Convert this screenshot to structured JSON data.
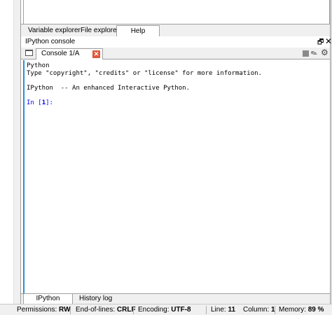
{
  "top_tabs": [
    {
      "label": "Variable explorer"
    },
    {
      "label": "File explorer"
    },
    {
      "label": "Help"
    }
  ],
  "console_pane": {
    "title": "IPython console",
    "undock_glyph": "🗗",
    "close_glyph": "✕",
    "tab_label": "Console 1/A",
    "tab_close_glyph": "✕",
    "eraser_glyph": "✎",
    "gear_glyph": "⚙"
  },
  "console_output": {
    "line1": "Python",
    "line2": "Type \"copyright\", \"credits\" or \"license\" for more information.",
    "line3": "IPython  -- An enhanced Interactive Python.",
    "prompt_prefix": "In [",
    "prompt_number": "1",
    "prompt_suffix": "]:"
  },
  "bottom_tabs": [
    {
      "label": "IPython console"
    },
    {
      "label": "History log"
    }
  ],
  "status_bar": {
    "permissions_label": "Permissions:",
    "permissions_value": "RW",
    "eol_label": "End-of-lines:",
    "eol_value": "CRLF",
    "encoding_label": "Encoding:",
    "encoding_value": "UTF-8",
    "line_label": "Line:",
    "line_value": "11",
    "column_label": "Column:",
    "column_value": "1",
    "memory_label": "Memory:",
    "memory_value": "89 %"
  },
  "colors": {
    "accent": "#2b8fd6",
    "prompt": "#0000ff",
    "tab_close": "#e0583c"
  }
}
